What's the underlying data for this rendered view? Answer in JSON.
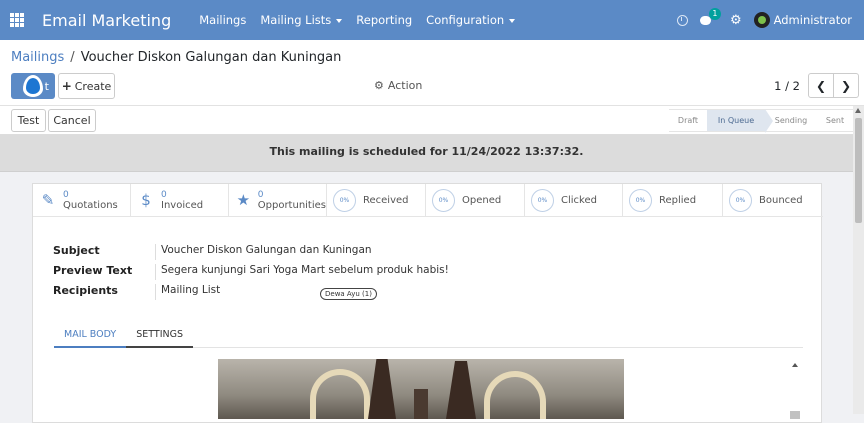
{
  "topbar": {
    "app_title": "Email Marketing",
    "menu": [
      "Mailings",
      "Mailing Lists",
      "Reporting",
      "Configuration"
    ],
    "menu_dropdown": [
      false,
      true,
      false,
      true
    ],
    "chat_badge": "1",
    "user_name": "Administrator",
    "colors": {
      "bar": "#5b8ac6",
      "badge": "#00a09d"
    }
  },
  "breadcrumb": {
    "parent": "Mailings",
    "separator": "/",
    "current": "Voucher Diskon Galungan dan Kuningan"
  },
  "control": {
    "edit_label": "t",
    "create_label": "Create",
    "action_label": "Action",
    "pager": "1 / 2"
  },
  "statusbar": {
    "test_label": "Test",
    "cancel_label": "Cancel",
    "stages": [
      "Draft",
      "In Queue",
      "Sending",
      "Sent"
    ],
    "active_stage": "In Queue"
  },
  "alert": {
    "text": "This mailing is scheduled for 11/24/2022 13:37:32."
  },
  "stats": [
    {
      "value": "0",
      "label": "Quotations",
      "icon": "pencil-icon"
    },
    {
      "value": "0",
      "label": "Invoiced",
      "icon": "dollar-icon"
    },
    {
      "value": "0",
      "label": "Opportunities",
      "icon": "star-icon"
    },
    {
      "pct": "0%",
      "label": "Received"
    },
    {
      "pct": "0%",
      "label": "Opened"
    },
    {
      "pct": "0%",
      "label": "Clicked"
    },
    {
      "pct": "0%",
      "label": "Replied"
    },
    {
      "pct": "0%",
      "label": "Bounced"
    }
  ],
  "fields": {
    "subject_label": "Subject",
    "subject_value": "Voucher Diskon Galungan dan Kuningan",
    "preview_label": "Preview Text",
    "preview_value": "Segera kunjungi Sari Yoga Mart sebelum produk habis!",
    "recipients_label": "Recipients",
    "recipients_value": "Mailing List",
    "recipient_tag": "Dewa Ayu (1)"
  },
  "tabs": [
    "MAIL BODY",
    "SETTINGS"
  ],
  "active_tab": "MAIL BODY"
}
